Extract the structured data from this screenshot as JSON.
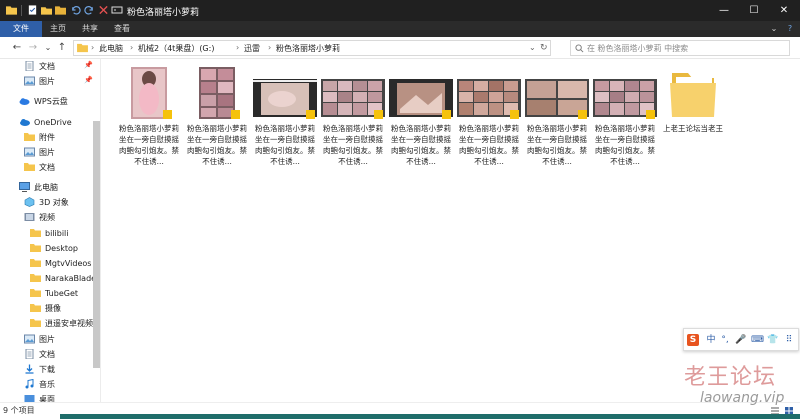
{
  "window": {
    "title": "粉色洛丽塔小萝莉",
    "minimize": "—",
    "maximize": "☐",
    "close": "✕"
  },
  "ribbon": {
    "tabs": [
      "文件",
      "主页",
      "共享",
      "查看"
    ],
    "expand": "⌄",
    "help": "?"
  },
  "address": {
    "back": "←",
    "forward": "→",
    "recent": "⌄",
    "up": "↑",
    "crumbs": [
      "此电脑",
      "机械2（4t果盘）(G:)",
      "迅雷",
      "粉色洛丽塔小萝莉"
    ],
    "separator": "›",
    "dropdown": "⌄",
    "refresh": "↻"
  },
  "search": {
    "placeholder": "在 粉色洛丽塔小萝莉 中搜索"
  },
  "nav": {
    "quick": [
      {
        "label": "文档",
        "pinned": true
      },
      {
        "label": "图片",
        "pinned": true
      }
    ],
    "wps": "WPS云盘",
    "onedrive": "OneDrive",
    "onedrive_items": [
      "附件",
      "图片",
      "文档"
    ],
    "thispc": "此电脑",
    "thispc_items": [
      "3D 对象",
      "视频"
    ],
    "video_folders": [
      "bilibili",
      "Desktop",
      "MgtvVideos",
      "NarakaBlade",
      "TubeGet",
      "摄像",
      "逍遥安卓视频"
    ],
    "more_items": [
      "图片",
      "文档",
      "下载",
      "音乐",
      "桌面"
    ]
  },
  "files": [
    {
      "name": "粉色洛丽塔小萝莉坐在一旁自慰摸摇肉鲍勾引炮友。禁不住诱...",
      "kind": "photo-portrait"
    },
    {
      "name": "粉色洛丽塔小萝莉坐在一旁自慰摸摇肉鲍勾引炮友。禁不住诱...",
      "kind": "collage-portrait"
    },
    {
      "name": "粉色洛丽塔小萝莉坐在一旁自慰摸摇肉鲍勾引炮友。禁不住诱...",
      "kind": "video"
    },
    {
      "name": "粉色洛丽塔小萝莉坐在一旁自慰摸摇肉鲍勾引炮友。禁不住诱...",
      "kind": "grid"
    },
    {
      "name": "粉色洛丽塔小萝莉坐在一旁自慰摸摇肉鲍勾引炮友。禁不住诱...",
      "kind": "video"
    },
    {
      "name": "粉色洛丽塔小萝莉坐在一旁自慰摸摇肉鲍勾引炮友。禁不住诱...",
      "kind": "grid"
    },
    {
      "name": "粉色洛丽塔小萝莉坐在一旁自慰摸摇肉鲍勾引炮友。禁不住诱...",
      "kind": "grid"
    },
    {
      "name": "粉色洛丽塔小萝莉坐在一旁自慰摸摇肉鲍勾引炮友。禁不住诱...",
      "kind": "grid"
    },
    {
      "name": "上老王论坛当老王",
      "kind": "folder"
    }
  ],
  "status": {
    "count": "9 个项目"
  },
  "ime": {
    "brand": "S",
    "mode": "中",
    "punct": "°,",
    "mic": "🎤",
    "keyboard": "⌨",
    "skin": "👕",
    "tools": "⠿"
  },
  "watermark": {
    "cn": "老王论坛",
    "en": "laowang.vip"
  },
  "colors": {
    "titlebar": "#202020",
    "ribbon": "#2b2b2b",
    "ribbon_active": "#2f5fa8",
    "folder": "#f5c54c",
    "teal": "#1f6d6a"
  }
}
